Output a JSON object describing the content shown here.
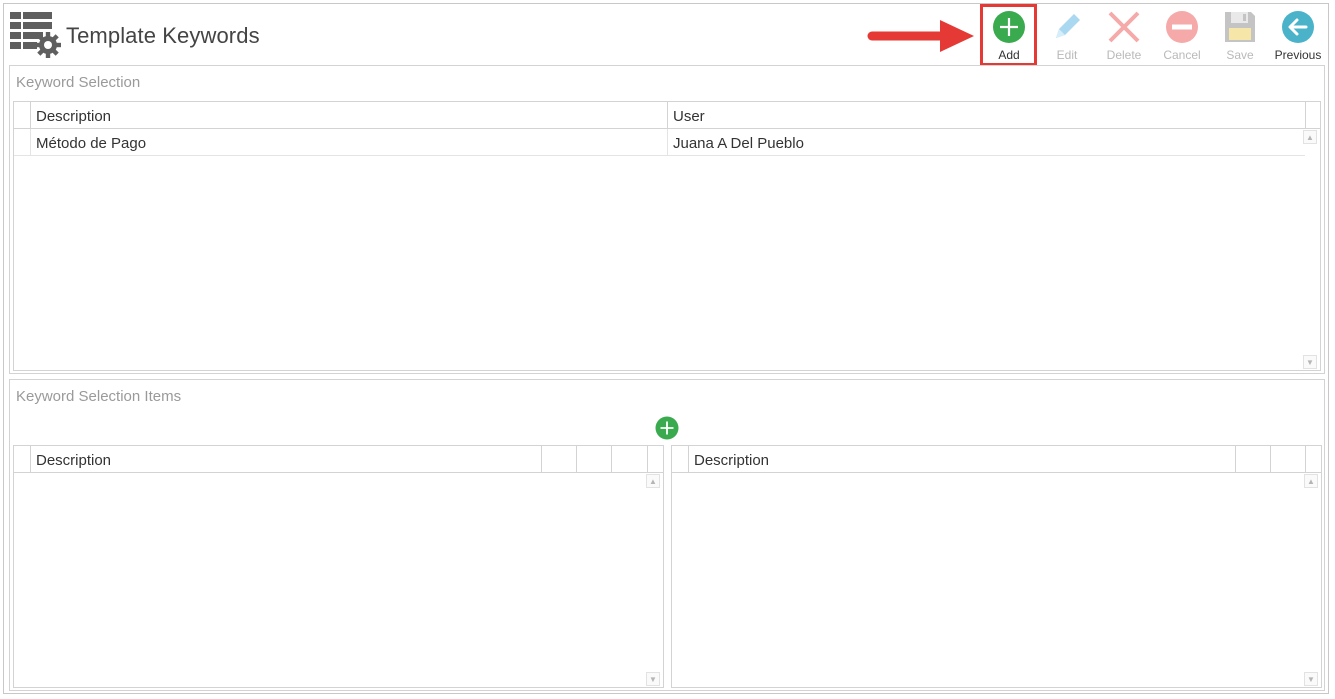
{
  "header": {
    "title": "Template Keywords"
  },
  "toolbar": {
    "add_label": "Add",
    "edit_label": "Edit",
    "delete_label": "Delete",
    "cancel_label": "Cancel",
    "save_label": "Save",
    "previous_label": "Previous"
  },
  "icons": {
    "app": "table-settings-icon",
    "add": "plus-circle-icon",
    "edit": "pencil-icon",
    "delete": "x-icon",
    "cancel": "minus-circle-icon",
    "save": "floppy-disk-icon",
    "previous": "arrow-left-circle-icon"
  },
  "colors": {
    "add_green": "#3aaa4f",
    "highlight_red": "#e53935",
    "edit_blue": "#9fd3ee",
    "delete_red": "#f3a7a7",
    "cancel_red": "#f3a7a7",
    "save_gray": "#bdbdbd",
    "previous_teal": "#4bb3c9"
  },
  "keyword_selection": {
    "title": "Keyword Selection",
    "columns": [
      "Description",
      "User"
    ],
    "rows": [
      {
        "description": "Método de Pago",
        "user": "Juana A Del Pueblo"
      }
    ]
  },
  "keyword_selection_items": {
    "title": "Keyword Selection Items",
    "left_grid": {
      "columns": [
        "Description"
      ]
    },
    "right_grid": {
      "columns": [
        "Description"
      ]
    }
  }
}
